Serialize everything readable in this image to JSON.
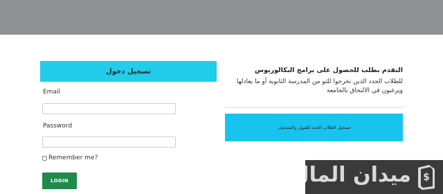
{
  "login": {
    "header": "تسجيل دخول",
    "email_label": "Email",
    "email_value": "",
    "password_label": "Password",
    "password_value": "",
    "remember_label": "Remember me?",
    "remember_checked": false,
    "login_button": "LOGIN"
  },
  "info": {
    "title": "التقدم بطلب للحصول على برامج البكالوريوس",
    "description": "للطلاب الجدد الذين تخرجوا للتو من المدرسة الثانوية أو ما يعادلها ويرغبون في الالتحاق بالجامعة",
    "notice": "تسجيل الطلاب الجدد للقبول والتسجيل."
  },
  "watermark": {
    "text": "ميدان المال",
    "icon": "money-document-icon"
  },
  "colors": {
    "topbar": "#8f9094",
    "accent": "#22cdea",
    "login_button": "#1f8a4c",
    "watermark_bg": "#3a3a3a"
  }
}
